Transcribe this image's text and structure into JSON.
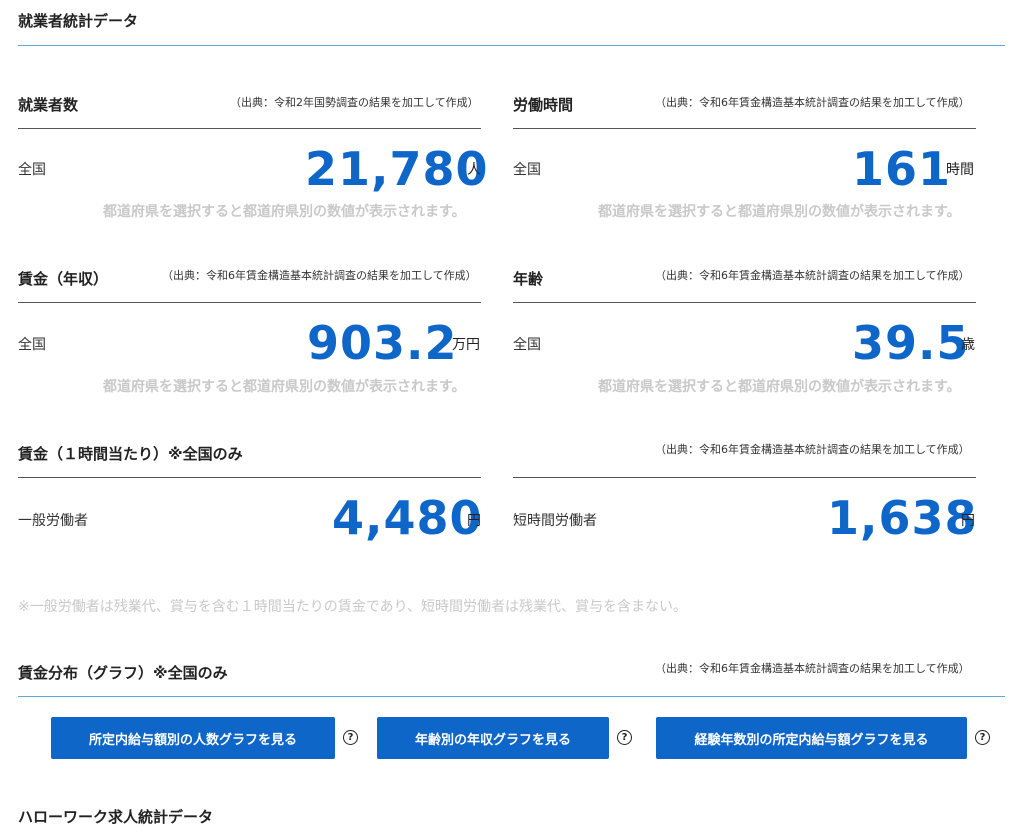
{
  "header": {
    "title": "就業者統計データ"
  },
  "cards": {
    "workers": {
      "title": "就業者数",
      "source": "（出典：令和2年国勢調査の結果を加工して作成）",
      "region": "全国",
      "value": "21,780",
      "unit": "人",
      "hint": "都道府県を選択すると都道府県別の数値が表示されます。"
    },
    "hours": {
      "title": "労働時間",
      "source": "（出典：令和6年賃金構造基本統計調査の結果を加工して作成）",
      "region": "全国",
      "value": "161",
      "unit": "時間",
      "hint": "都道府県を選択すると都道府県別の数値が表示されます。"
    },
    "income": {
      "title": "賃金（年収）",
      "source": "（出典：令和6年賃金構造基本統計調査の結果を加工して作成）",
      "region": "全国",
      "value": "903.2",
      "unit": "万円",
      "hint": "都道府県を選択すると都道府県別の数値が表示されます。"
    },
    "age": {
      "title": "年齢",
      "source": "（出典：令和6年賃金構造基本統計調査の結果を加工して作成）",
      "region": "全国",
      "value": "39.5",
      "unit": "歳",
      "hint": "都道府県を選択すると都道府県別の数値が表示されます。"
    },
    "hourly": {
      "title": "賃金（１時間当たり）※全国のみ",
      "source": "（出典：令和6年賃金構造基本統計調査の結果を加工して作成）",
      "general_label": "一般労働者",
      "general_value": "4,480",
      "general_unit": "円",
      "part_label": "短時間労働者",
      "part_value": "1,638",
      "part_unit": "円",
      "note": "※一般労働者は残業代、賞与を含む１時間当たりの賃金であり、短時間労働者は残業代、賞与を含まない。"
    }
  },
  "distribution": {
    "title": "賃金分布（グラフ）※全国のみ",
    "source": "（出典：令和6年賃金構造基本統計調査の結果を加工して作成）",
    "buttons": [
      {
        "label": "所定内給与額別の人数グラフを見る"
      },
      {
        "label": "年齢別の年収グラフを見る"
      },
      {
        "label": "経験年数別の所定内給与額グラフを見る"
      }
    ],
    "help_glyph": "?"
  },
  "footer": {
    "title": "ハローワーク求人統計データ"
  },
  "colors": {
    "accent": "#0e66c8",
    "rule": "#5aa9d9",
    "hint": "#c9c9c9"
  }
}
